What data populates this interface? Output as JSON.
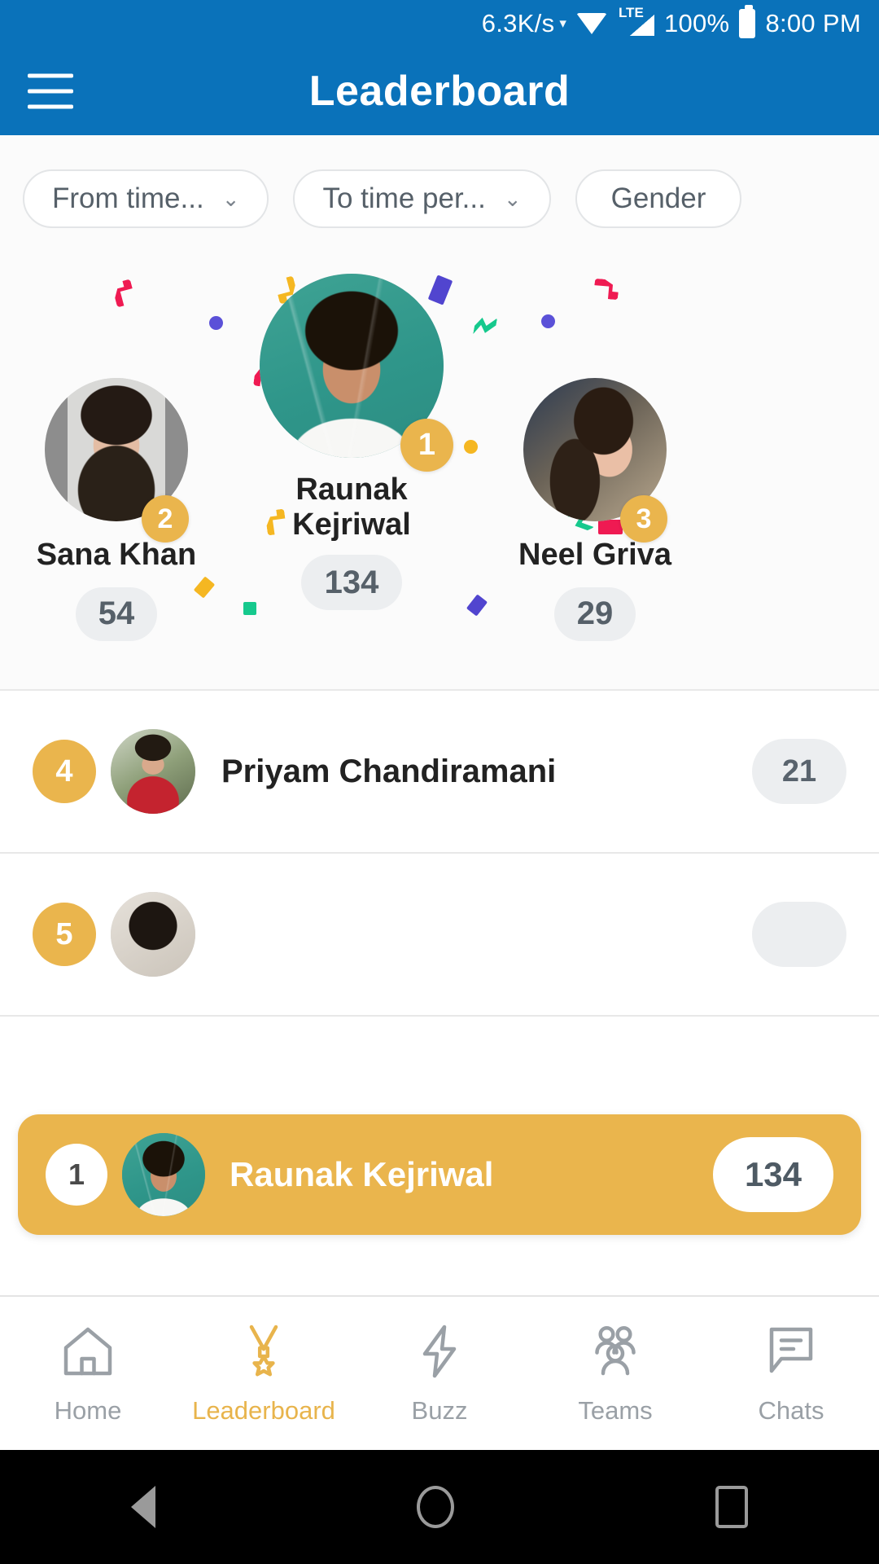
{
  "status_bar": {
    "network_speed": "6.3K/s",
    "network_type": "LTE",
    "battery_percent": "100%",
    "time": "8:00 PM",
    "icons": [
      "caret-down-icon",
      "wifi-icon",
      "signal-bars-icon",
      "battery-icon"
    ]
  },
  "app_bar": {
    "menu_icon": "hamburger-menu-icon",
    "title": "Leaderboard"
  },
  "filters": [
    {
      "label": "From time...",
      "has_chevron": true
    },
    {
      "label": "To time per...",
      "has_chevron": true
    },
    {
      "label": "Gender",
      "has_chevron": false
    }
  ],
  "podium": {
    "first": {
      "rank": "1",
      "name_line1": "Raunak",
      "name_line2": "Kejriwal",
      "name": "Raunak Kejriwal",
      "score": "134"
    },
    "second": {
      "rank": "2",
      "name": "Sana  Khan",
      "score": "54"
    },
    "third": {
      "rank": "3",
      "name": "Neel Griva",
      "score": "29"
    }
  },
  "list_rows": [
    {
      "rank": "4",
      "name": "Priyam Chandiramani",
      "score": "21"
    },
    {
      "rank": "5",
      "name": "",
      "score": ""
    }
  ],
  "self_bar": {
    "rank": "1",
    "name": "Raunak Kejriwal",
    "score": "134"
  },
  "bottom_nav": [
    {
      "label": "Home",
      "icon": "home-icon",
      "active": false
    },
    {
      "label": "Leaderboard",
      "icon": "medal-icon",
      "active": true
    },
    {
      "label": "Buzz",
      "icon": "lightning-icon",
      "active": false
    },
    {
      "label": "Teams",
      "icon": "people-group-icon",
      "active": false
    },
    {
      "label": "Chats",
      "icon": "chat-bubble-icon",
      "active": false
    }
  ],
  "android_nav": {
    "back": "back-triangle-icon",
    "home": "home-circle-icon",
    "recents": "recents-square-icon"
  },
  "colors": {
    "app_bar": "#0a72ba",
    "accent_gold": "#eab54d",
    "pill_grey": "#eceef0",
    "text_dark": "#222222",
    "text_muted": "#9aa0a6"
  },
  "confetti": {
    "pink": "#ef1a52",
    "yellow": "#f5b722",
    "purple": "#5145cf",
    "green": "#16c98d",
    "blue_dot": "#5b51d8"
  }
}
